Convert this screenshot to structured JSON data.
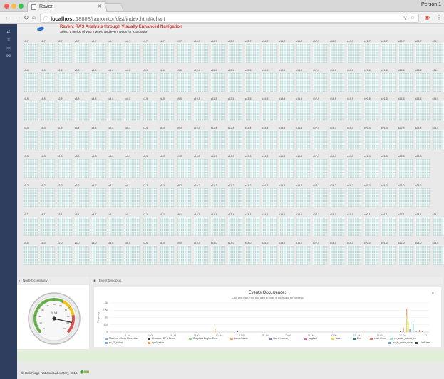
{
  "browser": {
    "tab_title": "Raven",
    "profile": "Person 1",
    "url_host": "localhost",
    "url_path": ":18888/ramonitor/dist/index.html#chart"
  },
  "header": {
    "title": "Raven: RAS Analysis through Visually Enhanced Navigation",
    "subtitle": "Select a period of your interest and event types for exploration"
  },
  "node_grid": {
    "cabinet_count": 25,
    "rows": [
      {
        "suffix": "-7",
        "last": 24
      },
      {
        "suffix": "-6",
        "last": 24
      },
      {
        "suffix": "-5",
        "last": 24
      },
      {
        "suffix": "-4",
        "last": 24
      },
      {
        "suffix": "-3",
        "last": 23
      },
      {
        "suffix": "-2",
        "last": 23
      },
      {
        "suffix": "-1",
        "last": 24
      },
      {
        "suffix": "-0",
        "last": 24
      }
    ]
  },
  "panels": {
    "node_occupancy_title": "Node Occupancy",
    "event_synopsis_title": "Event Synopsis"
  },
  "gauge": {
    "center_label": "% full",
    "ticks": [
      "0",
      "10",
      "20",
      "30",
      "40",
      "50",
      "60",
      "70",
      "80",
      "90",
      "100"
    ],
    "value": 88
  },
  "chart_data": {
    "type": "bar",
    "title": "Events Occurrences",
    "subtitle": "Click and drag in the plot area to zoom in (Shift-click for panning)",
    "ylabel": "Frequency",
    "yticks": [
      "2k",
      "1.5k",
      "1k",
      "500",
      "0"
    ],
    "ylim": [
      0,
      2000
    ],
    "xticks": [
      "8. Jul",
      "12:00",
      "9. Jul",
      "12:00",
      "10. Jul",
      "12:00",
      "11. Jul",
      "12:00",
      "12. Jul",
      "12:00",
      "13. Jul",
      "12:00",
      "14. Jul",
      "12"
    ],
    "series": [
      {
        "name": "Machine Check Exception",
        "color": "#8fa6e8",
        "points": [
          [
            0.83,
            20
          ],
          [
            0.92,
            60
          ]
        ]
      },
      {
        "name": "Unknown GPU Error",
        "color": "#3b3b3b",
        "points": [
          [
            0.4,
            60
          ],
          [
            0.91,
            40
          ]
        ]
      },
      {
        "name": "Graphics Engine Error",
        "color": "#8fde7e",
        "points": [
          [
            0.58,
            20
          ],
          [
            0.93,
            80
          ]
        ]
      },
      {
        "name": "kernel panic",
        "color": "#f3a35c",
        "points": [
          [
            0.33,
            250
          ],
          [
            0.93,
            1600
          ]
        ]
      },
      {
        "name": "Out of memory",
        "color": "#7a7fd1",
        "points": [
          [
            0.94,
            200
          ]
        ]
      },
      {
        "name": "segfault",
        "color": "#e56b9e",
        "points": [
          [
            0.97,
            40
          ]
        ]
      },
      {
        "name": "lustre",
        "color": "#e0dd4c",
        "points": [
          [
            0.93,
            1100
          ],
          [
            0.935,
            700
          ]
        ]
      },
      {
        "name": "Lfn",
        "color": "#2c7f80",
        "points": [
          [
            0.95,
            600
          ]
        ]
      },
      {
        "name": "LNet Error",
        "color": "#f26d6d",
        "points": [
          [
            0.97,
            150
          ]
        ]
      },
      {
        "name": "ec_sedc_collect_err",
        "color": "#8be3dc",
        "points": [
          [
            0.9,
            30
          ]
        ]
      },
      {
        "name": "ec_l0_node_down",
        "color": "#6fa0d8",
        "points": [
          [
            0.96,
            100
          ]
        ]
      },
      {
        "name": "LinkError",
        "color": "#4a4a4a",
        "points": [
          [
            0.98,
            50
          ]
        ]
      },
      {
        "name": "ec_l1_failed",
        "color": "#7cb8ef",
        "points": [
          [
            0.88,
            20
          ]
        ]
      },
      {
        "name": "Application",
        "color": "#f0a05a",
        "points": [
          [
            0.92,
            300
          ]
        ]
      }
    ]
  },
  "footer": {
    "copyright": "© Oak Ridge National Laboratory, 2016"
  }
}
